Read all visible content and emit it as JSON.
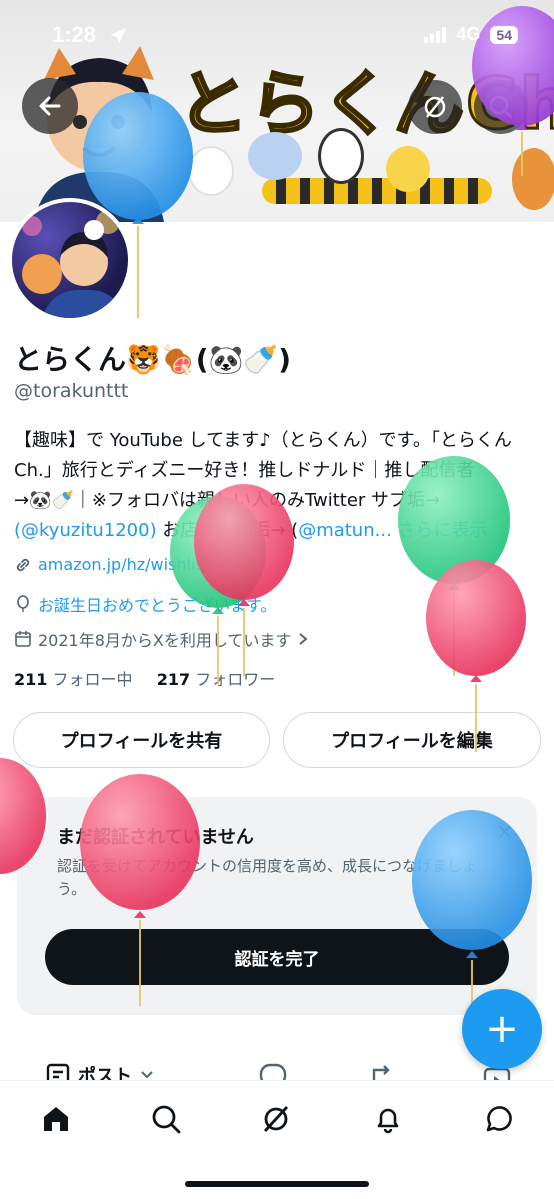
{
  "status": {
    "time": "1:28",
    "network": "4G",
    "battery": "54"
  },
  "banner": {
    "title": "とらくんCh"
  },
  "profile": {
    "display_name": "とらくん🐯🍖(🐼🍼)",
    "handle": "@torakunttt",
    "bio": {
      "line1": "【趣味】で YouTube してます♪（とらくん）です。「とらくん",
      "line2": "Ch.」旅行とディズニー好き！推しドナルド｜推し配信者",
      "line3": "→🐼🍼｜※フォロバは親しい人のみTwitter サブ垢→",
      "link1": "(@kyuzitu1200)",
      "mid": " お店の専門垢→ (",
      "link2": "@matun...",
      "more": "さらに表示"
    },
    "link_url": "amazon.jp/hz/wishlist",
    "birthday": "お誕生日おめでとうございます。",
    "joined": "2021年8月からXを利用しています",
    "following_count": "211",
    "following_label": "フォロー中",
    "followers_count": "217",
    "followers_label": "フォロワー"
  },
  "actions": {
    "share": "プロフィールを共有",
    "edit": "プロフィールを編集"
  },
  "verify": {
    "title": "まだ認証されていません",
    "text": "認証を受けてアカウントの信用度を高め、成長につなげましょう。",
    "button": "認証を完了",
    "close": "×"
  },
  "tabs": {
    "posts": "ポスト"
  },
  "fab": {
    "label": "+"
  },
  "colors": {
    "accent": "#1d9bf0",
    "balloon_blue": "#3aa6f0",
    "balloon_green": "#35d68f",
    "balloon_red": "#ec4d6e",
    "balloon_purple": "#a35ad8"
  }
}
